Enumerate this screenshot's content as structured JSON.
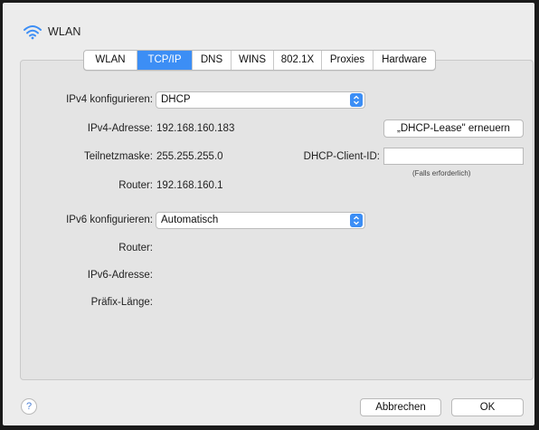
{
  "window": {
    "title": "WLAN"
  },
  "tabs": [
    {
      "label": "WLAN",
      "active": false
    },
    {
      "label": "TCP/IP",
      "active": true
    },
    {
      "label": "DNS",
      "active": false
    },
    {
      "label": "WINS",
      "active": false
    },
    {
      "label": "802.1X",
      "active": false
    },
    {
      "label": "Proxies",
      "active": false
    },
    {
      "label": "Hardware",
      "active": false
    }
  ],
  "ipv4": {
    "configure_label": "IPv4 konfigurieren:",
    "configure_value": "DHCP",
    "address_label": "IPv4-Adresse:",
    "address_value": "192.168.160.183",
    "subnet_label": "Teilnetzmaske:",
    "subnet_value": "255.255.255.0",
    "router_label": "Router:",
    "router_value": "192.168.160.1",
    "renew_button": "„DHCP-Lease\" erneuern",
    "client_id_label": "DHCP-Client-ID:",
    "client_id_value": "",
    "client_id_hint": "(Falls erforderlich)"
  },
  "ipv6": {
    "configure_label": "IPv6 konfigurieren:",
    "configure_value": "Automatisch",
    "router_label": "Router:",
    "address_label": "IPv6-Adresse:",
    "prefix_label": "Präfix-Länge:"
  },
  "footer": {
    "help": "?",
    "cancel": "Abbrechen",
    "ok": "OK"
  },
  "colors": {
    "accent": "#3c8ef5",
    "background": "#ececec"
  }
}
